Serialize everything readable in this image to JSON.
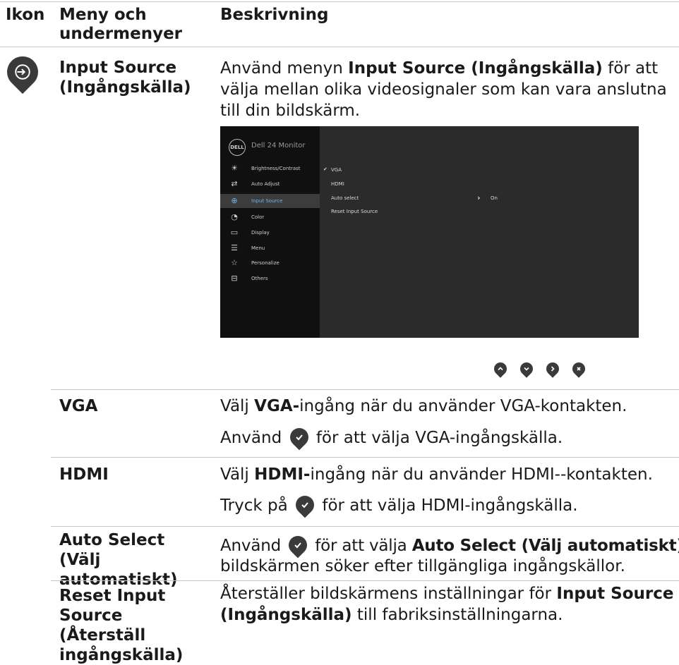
{
  "header": {
    "col_icon": "Ikon",
    "col_menu": "Meny och undermenyer",
    "col_desc": "Beskrivning"
  },
  "input_source": {
    "label": "Input Source (Ingångskälla)",
    "desc_pre": "Använd menyn ",
    "desc_bold": "Input Source (Ingångskälla)",
    "desc_post": " för att välja mellan olika videosignaler som kan vara anslutna till din bildskärm.",
    "icon": "input-source-icon"
  },
  "osd": {
    "title": "Dell 24 Monitor",
    "logo_text": "DELL",
    "menu_items": [
      {
        "label": "Brightness/Contrast",
        "icon": "brightness-icon"
      },
      {
        "label": "Auto Adjust",
        "icon": "auto-adjust-icon"
      },
      {
        "label": "Input Source",
        "icon": "input-source-icon",
        "active": true
      },
      {
        "label": "Color",
        "icon": "color-icon"
      },
      {
        "label": "Display",
        "icon": "display-icon"
      },
      {
        "label": "Menu",
        "icon": "menu-icon"
      },
      {
        "label": "Personalize",
        "icon": "star-icon"
      },
      {
        "label": "Others",
        "icon": "others-icon"
      }
    ],
    "options": [
      {
        "label": "VGA",
        "checked": true
      },
      {
        "label": "HDMI"
      },
      {
        "label": "Auto select",
        "value": "On"
      },
      {
        "label": "Reset Input Source"
      }
    ]
  },
  "nav_buttons": [
    "up-icon",
    "down-icon",
    "right-icon",
    "close-icon"
  ],
  "rows": [
    {
      "label": "VGA",
      "line1_pre": "Välj ",
      "line1_bold": "VGA-",
      "line1_post": "ingång när du använder VGA-kontakten.",
      "line2_pre": "Använd ",
      "line2_post": " för att välja VGA-ingångskälla."
    },
    {
      "label": "HDMI",
      "line1_pre": "Välj ",
      "line1_bold": "HDMI-",
      "line1_post": "ingång när du använder HDMI--kontakten.",
      "line2_pre": "Tryck på ",
      "line2_post": " för att välja HDMI-ingångskälla."
    },
    {
      "label": "Auto Select (Välj automatiskt)",
      "line1_pre": "Använd ",
      "line1_mid": " för att välja ",
      "line1_bold": "Auto Select (Välj automatiskt)",
      "line1_post": ",",
      "line2": "bildskärmen söker efter tillgängliga ingångskällor."
    },
    {
      "label": "Reset Input Source (Återställ ingångskälla)",
      "line1_pre": "Återställer bildskärmens inställningar för ",
      "line1_bold": "Input Source (Ingångskälla)",
      "line1_post": " till fabriksinställningarna."
    }
  ]
}
